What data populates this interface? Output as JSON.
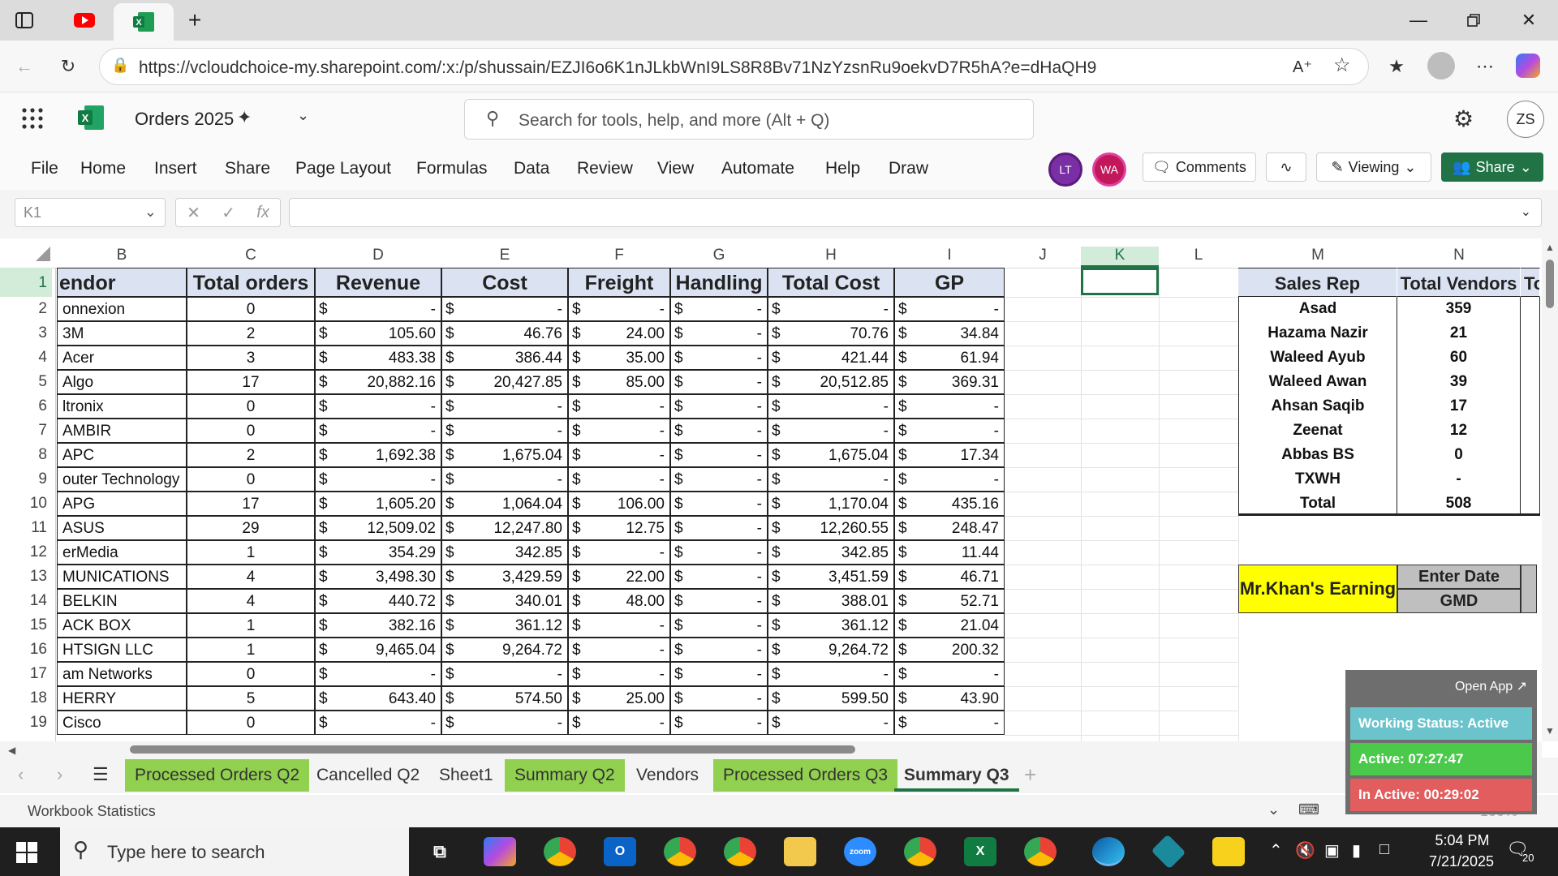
{
  "browser": {
    "url": "https://vcloudchoice-my.sharepoint.com/:x:/p/shussain/EZJI6o6K1nJLkbWnI9LS8R8Bv71NzYzsnRu9oekvD7R5hA?e=dHaQH9"
  },
  "excel": {
    "doc_title": "Orders 2025",
    "search_placeholder": "Search for tools, help, and more (Alt + Q)",
    "user_initials": "ZS",
    "menu": [
      "File",
      "Home",
      "Insert",
      "Share",
      "Page Layout",
      "Formulas",
      "Data",
      "Review",
      "View",
      "Automate",
      "Help",
      "Draw"
    ],
    "presence": [
      {
        "initials": "LT",
        "color": "#7b2fa4"
      },
      {
        "initials": "WA",
        "color": "#c2185b"
      }
    ],
    "comments_label": "Comments",
    "viewing_label": "Viewing",
    "share_label": "Share",
    "accent": "#217346",
    "name_box": "K1"
  },
  "grid": {
    "columns": [
      "B",
      "C",
      "D",
      "E",
      "F",
      "G",
      "H",
      "I",
      "J",
      "K",
      "L",
      "M",
      "N"
    ],
    "row_numbers": [
      "1",
      "2",
      "3",
      "4",
      "5",
      "6",
      "7",
      "8",
      "9",
      "10",
      "11",
      "12",
      "13",
      "14",
      "15",
      "16",
      "17",
      "18",
      "19"
    ],
    "table_headers": [
      "endor",
      "Total orders",
      "Revenue",
      "Cost",
      "Freight",
      "Handling",
      "Total Cost",
      "GP"
    ],
    "rows": [
      [
        "onnexion",
        "0",
        "-",
        "-",
        "-",
        "-",
        "-",
        "-"
      ],
      [
        "3M",
        "2",
        "105.60",
        "46.76",
        "24.00",
        "-",
        "70.76",
        "34.84"
      ],
      [
        "Acer",
        "3",
        "483.38",
        "386.44",
        "35.00",
        "-",
        "421.44",
        "61.94"
      ],
      [
        "Algo",
        "17",
        "20,882.16",
        "20,427.85",
        "85.00",
        "-",
        "20,512.85",
        "369.31"
      ],
      [
        "ltronix",
        "0",
        "-",
        "-",
        "-",
        "-",
        "-",
        "-"
      ],
      [
        "AMBIR",
        "0",
        "-",
        "-",
        "-",
        "-",
        "-",
        "-"
      ],
      [
        "APC",
        "2",
        "1,692.38",
        "1,675.04",
        "-",
        "-",
        "1,675.04",
        "17.34"
      ],
      [
        "outer Technology",
        "0",
        "-",
        "-",
        "-",
        "-",
        "-",
        "-"
      ],
      [
        "APG",
        "17",
        "1,605.20",
        "1,064.04",
        "106.00",
        "-",
        "1,170.04",
        "435.16"
      ],
      [
        "ASUS",
        "29",
        "12,509.02",
        "12,247.80",
        "12.75",
        "-",
        "12,260.55",
        "248.47"
      ],
      [
        "erMedia",
        "1",
        "354.29",
        "342.85",
        "-",
        "-",
        "342.85",
        "11.44"
      ],
      [
        "MUNICATIONS",
        "4",
        "3,498.30",
        "3,429.59",
        "22.00",
        "-",
        "3,451.59",
        "46.71"
      ],
      [
        "BELKIN",
        "4",
        "440.72",
        "340.01",
        "48.00",
        "-",
        "388.01",
        "52.71"
      ],
      [
        "ACK BOX",
        "1",
        "382.16",
        "361.12",
        "-",
        "-",
        "361.12",
        "21.04"
      ],
      [
        "HTSIGN LLC",
        "1",
        "9,465.04",
        "9,264.72",
        "-",
        "-",
        "9,264.72",
        "200.32"
      ],
      [
        "am Networks",
        "0",
        "-",
        "-",
        "-",
        "-",
        "-",
        "-"
      ],
      [
        "HERRY",
        "5",
        "643.40",
        "574.50",
        "25.00",
        "-",
        "599.50",
        "43.90"
      ],
      [
        "Cisco",
        "0",
        "-",
        "-",
        "-",
        "-",
        "-",
        "-"
      ]
    ],
    "currency_symbol": "$",
    "sales_headers": [
      "Sales Rep",
      "Total Vendors",
      "To"
    ],
    "sales_rows": [
      [
        "Asad",
        "359"
      ],
      [
        "Hazama Nazir",
        "21"
      ],
      [
        "Waleed Ayub",
        "60"
      ],
      [
        "Waleed Awan",
        "39"
      ],
      [
        "Ahsan Saqib",
        "17"
      ],
      [
        "Zeenat",
        "12"
      ],
      [
        "Abbas BS",
        "0"
      ],
      [
        "TXWH",
        "-"
      ],
      [
        "Total",
        "508"
      ]
    ],
    "earning_label": "Mr.Khan's Earning",
    "enter_date_label": "Enter Date",
    "gmd_label": "GMD",
    "header_fill": "#dbe3f3",
    "earning_fill": "#ffff00"
  },
  "sheet_tabs": [
    {
      "label": "Processed Orders Q2",
      "green": true
    },
    {
      "label": "Cancelled Q2",
      "green": false
    },
    {
      "label": "Sheet1",
      "green": false
    },
    {
      "label": "Summary Q2",
      "green": true
    },
    {
      "label": "Vendors",
      "green": false
    },
    {
      "label": "Processed Orders Q3",
      "green": true
    },
    {
      "label": "Summary Q3",
      "green": false,
      "active": true
    }
  ],
  "status": {
    "workbook_statistics": "Workbook Statistics",
    "zoom": "100%"
  },
  "widget": {
    "open_app": "Open App ↗",
    "working_status": "Working Status: Active",
    "active": "Active: 07:27:47",
    "inactive": "In Active: 00:29:02"
  },
  "taskbar": {
    "search_placeholder": "Type here to search",
    "time": "5:04 PM",
    "date": "7/21/2025",
    "notifications": "20"
  }
}
